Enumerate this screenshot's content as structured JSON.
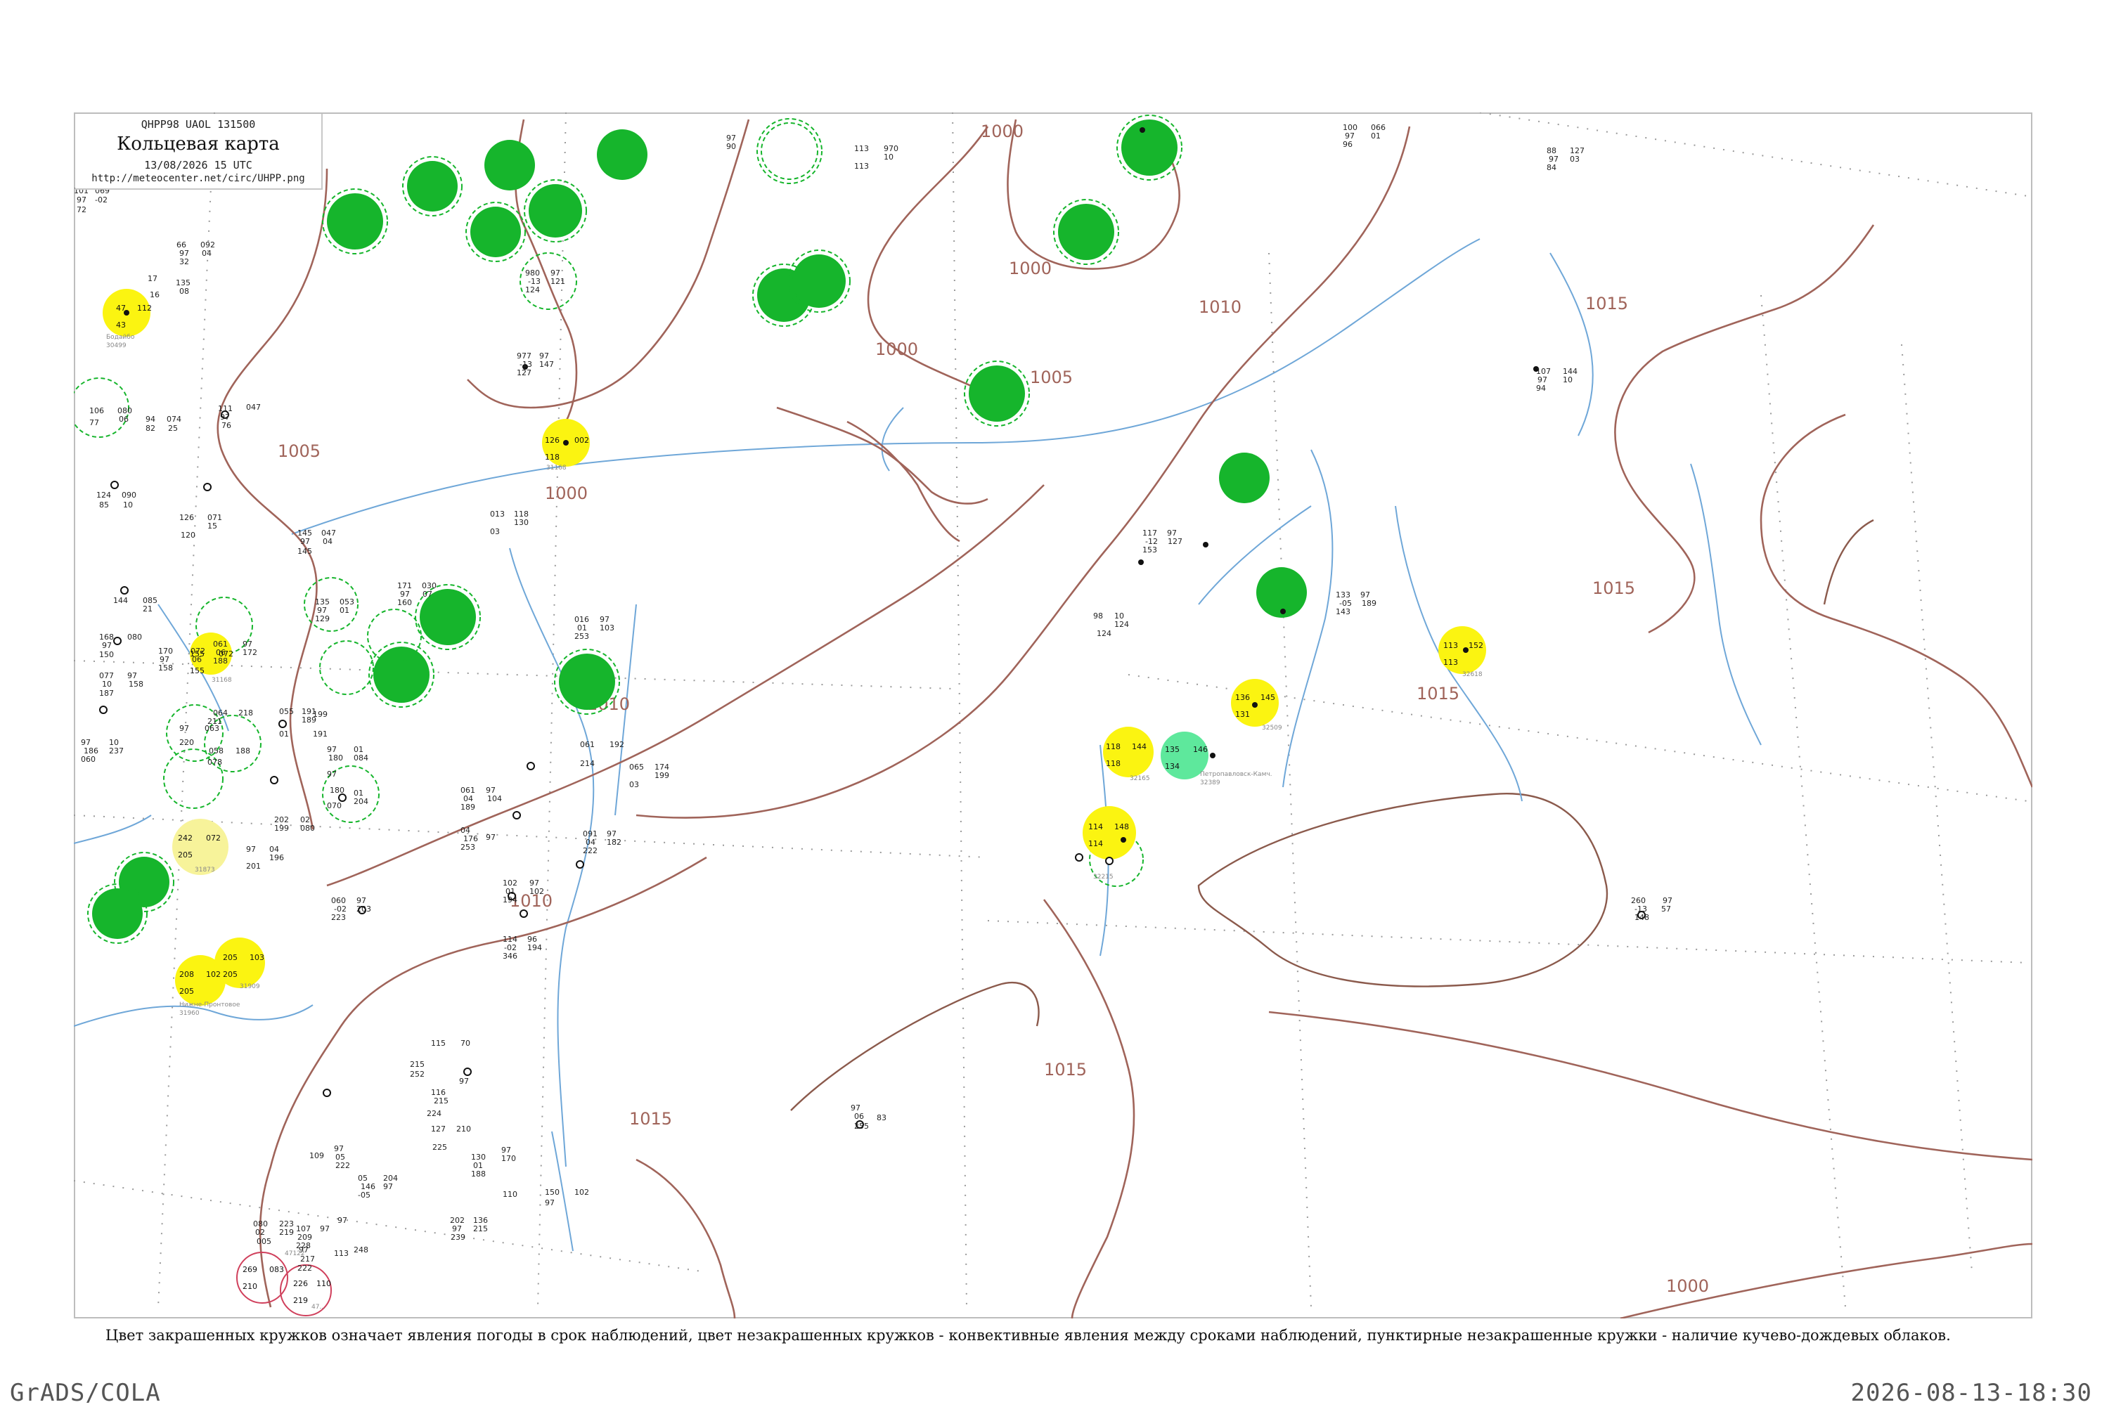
{
  "header": {
    "code": "QHPP98  UAOL  131500",
    "title": "Кольцевая карта",
    "date": "13/08/2026 15 UTC",
    "url": "http://meteocenter.net/circ/UHPP.png"
  },
  "caption": "Цвет закрашенных кружков означает явления погоды в срок наблюдений, цвет незакрашенных кружков - конвективные явления между сроками наблюдений, пунктирные незакрашенные кружки - наличие кучево-дождевых облаков.",
  "footer": {
    "left": "GrADS/COLA",
    "right": "2026-08-13-18:30"
  },
  "colors": {
    "isobar": "#a0645a",
    "river": "#6fa7d8",
    "green": "#16b52c",
    "yellow": "#fbf411",
    "pale_yellow": "#f7f39a",
    "aqua_green": "#5ee89c",
    "red_ring": "#d0405c"
  },
  "isobar_labels": [
    {
      "id": "1000a",
      "text": "1000"
    },
    {
      "id": "1000b",
      "text": "1000"
    },
    {
      "id": "1000c",
      "text": "1000"
    },
    {
      "id": "1000d",
      "text": "1000"
    },
    {
      "id": "1005a",
      "text": "1005"
    },
    {
      "id": "1005b",
      "text": "1005"
    },
    {
      "id": "1010a",
      "text": "1010"
    },
    {
      "id": "1010b",
      "text": "1010"
    },
    {
      "id": "1010c",
      "text": "1010"
    },
    {
      "id": "1015a",
      "text": "1015"
    },
    {
      "id": "1015b",
      "text": "1015"
    },
    {
      "id": "1015c",
      "text": "1015"
    },
    {
      "id": "1015d",
      "text": "1015"
    },
    {
      "id": "1015e",
      "text": "1015"
    },
    {
      "id": "1000e",
      "text": "1000"
    }
  ],
  "stations": [
    {
      "kind": "filled",
      "color": "green",
      "temp": "",
      "pres": "",
      "dew": "",
      "wmo": "24...",
      "label": ""
    },
    {
      "kind": "filled",
      "color": "yellow",
      "temp": "47",
      "pres": "112",
      "dew": "43",
      "wmo": "30499",
      "label": "Бодайбо"
    },
    {
      "kind": "filled",
      "color": "yellow",
      "temp": "126",
      "pres": "002",
      "dew": "118",
      "wmo": "31168",
      "label": ""
    },
    {
      "kind": "filled",
      "color": "yellow",
      "temp": "155",
      "pres": "072",
      "dew": "155",
      "wmo": "31168",
      "label": ""
    },
    {
      "kind": "filled",
      "color": "pale_yellow",
      "temp": "242",
      "pres": "072",
      "dew": "205",
      "wmo": "31873",
      "label": ""
    },
    {
      "kind": "filled",
      "color": "yellow",
      "temp": "208",
      "pres": "102",
      "dew": "205",
      "wmo": "31960",
      "label": "Нижне-Пронтовое"
    },
    {
      "kind": "filled",
      "color": "yellow",
      "temp": "205",
      "pres": "103",
      "dew": "205",
      "wmo": "31909",
      "label": ""
    },
    {
      "kind": "filled",
      "color": "yellow",
      "temp": "118",
      "pres": "144",
      "dew": "118",
      "wmo": "32165",
      "label": ""
    },
    {
      "kind": "filled",
      "color": "yellow",
      "temp": "114",
      "pres": "148",
      "dew": "114",
      "wmo": "32215",
      "label": ""
    },
    {
      "kind": "filled",
      "color": "yellow",
      "temp": "136",
      "pres": "145",
      "dew": "131",
      "wmo": "32509",
      "label": ""
    },
    {
      "kind": "filled",
      "color": "yellow",
      "temp": "113",
      "pres": "152",
      "dew": "113",
      "wmo": "32618",
      "label": ""
    },
    {
      "kind": "filled",
      "color": "aqua_green",
      "temp": "135",
      "pres": "146",
      "dew": "134",
      "wmo": "32389",
      "label": "Петропавловск-Камч."
    },
    {
      "kind": "open",
      "color": "red_ring",
      "temp": "269",
      "pres": "083",
      "dew": "210",
      "wmo": "47122",
      "label": ""
    },
    {
      "kind": "open",
      "color": "red_ring",
      "temp": "226",
      "pres": "110",
      "dew": "219",
      "wmo": "47...",
      "label": ""
    }
  ],
  "plain_values": [
    "101",
    "069",
    "97",
    "-02",
    "72",
    "66",
    "092",
    "97",
    "04",
    "32",
    "17",
    "135",
    "08",
    "16",
    "106",
    "080",
    "77",
    "06",
    "111",
    "047",
    "97",
    "76",
    "94",
    "25",
    "82",
    "074",
    "124",
    "090",
    "85",
    "10",
    "126",
    "071",
    "120",
    "15",
    "145",
    "047",
    "97",
    "04",
    "145",
    "135",
    "053",
    "97",
    "01",
    "129",
    "171",
    "030",
    "97",
    "07",
    "160",
    "144",
    "085",
    "21",
    "168",
    "080",
    "97",
    "150",
    "170",
    "072",
    "97",
    "06",
    "158",
    "077",
    "97",
    "10",
    "158",
    "187",
    "061",
    "97",
    "06",
    "172",
    "188",
    "064",
    "218",
    "97",
    "063",
    "211",
    "220",
    "058",
    "188",
    "078",
    "97",
    "10",
    "186",
    "237",
    "060",
    "97",
    "01",
    "180",
    "084",
    "97",
    "01",
    "180",
    "204",
    "070",
    "202",
    "02",
    "199",
    "080",
    "97",
    "04",
    "196",
    "201",
    "060",
    "97",
    "-02",
    "203",
    "223",
    "199",
    "191",
    "055",
    "191",
    "01",
    "189",
    "061",
    "97",
    "04",
    "104",
    "189",
    "04",
    "97",
    "176",
    "253",
    "016",
    "97",
    "01",
    "103",
    "253",
    "061",
    "192",
    "214",
    "065",
    "174",
    "03",
    "199",
    "091",
    "97",
    "04",
    "182",
    "222",
    "102",
    "97",
    "01",
    "102",
    "194",
    "114",
    "96",
    "-02",
    "194",
    "346",
    "115",
    "70",
    "215",
    "252",
    "116",
    "97",
    "215",
    "224",
    "127",
    "210",
    "225",
    "109",
    "97",
    "05",
    "222",
    "130",
    "97",
    "01",
    "170",
    "188",
    "150",
    "102",
    "110",
    "97",
    "05",
    "204",
    "146",
    "97",
    "-05",
    "202",
    "136",
    "97",
    "215",
    "239",
    "107",
    "97",
    "209",
    "228",
    "97",
    "217",
    "222",
    "080",
    "223",
    "02",
    "219",
    "005",
    "97",
    "113",
    "248",
    "97",
    "06",
    "83",
    "255",
    "260",
    "97",
    "-13",
    "57",
    "148",
    "133",
    "97",
    "-05",
    "189",
    "143",
    "117",
    "97",
    "-12",
    "127",
    "153",
    "977",
    "97",
    "-13",
    "147",
    "127",
    "980",
    "97",
    "-13",
    "121",
    "124",
    "013",
    "118",
    "03",
    "130",
    "98",
    "124",
    "10",
    "124",
    "113",
    "970",
    "10",
    "113",
    "100",
    "066",
    "97",
    "01",
    "96",
    "88",
    "127",
    "97",
    "03",
    "84",
    "107",
    "144",
    "97",
    "10",
    "94",
    "97",
    "90"
  ]
}
